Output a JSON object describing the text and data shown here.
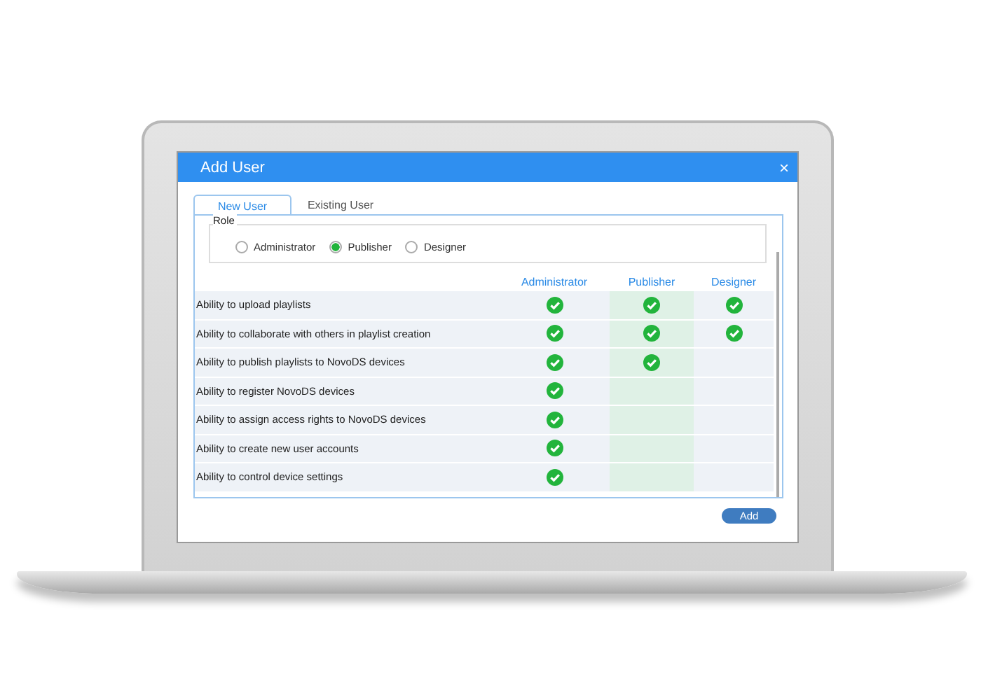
{
  "dialog": {
    "title": "Add User",
    "close": "×"
  },
  "tabs": [
    {
      "label": "New User",
      "selected": true
    },
    {
      "label": "Existing User",
      "selected": false
    }
  ],
  "role": {
    "legend": "Role",
    "options": [
      {
        "label": "Administrator",
        "selected": false
      },
      {
        "label": "Publisher",
        "selected": true
      },
      {
        "label": "Designer",
        "selected": false
      }
    ]
  },
  "table": {
    "columns": [
      "Administrator",
      "Publisher",
      "Designer"
    ],
    "rows": [
      {
        "label": "Ability to upload playlists",
        "checks": [
          true,
          true,
          true
        ]
      },
      {
        "label": "Ability to collaborate with others in playlist creation",
        "checks": [
          true,
          true,
          true
        ]
      },
      {
        "label": "Ability to publish playlists to NovoDS devices",
        "checks": [
          true,
          true,
          false
        ]
      },
      {
        "label": "Ability to register NovoDS devices",
        "checks": [
          true,
          false,
          false
        ]
      },
      {
        "label": "Ability to assign access rights to NovoDS devices",
        "checks": [
          true,
          false,
          false
        ]
      },
      {
        "label": "Ability to create new user accounts",
        "checks": [
          true,
          false,
          false
        ]
      },
      {
        "label": "Ability to control device settings",
        "checks": [
          true,
          false,
          false
        ]
      }
    ]
  },
  "buttons": [
    "Add"
  ]
}
